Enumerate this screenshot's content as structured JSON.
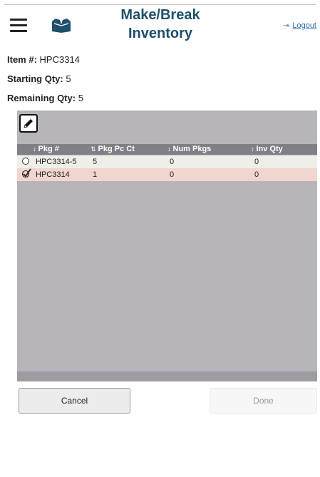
{
  "header": {
    "title_line1": "Make/Break",
    "title_line2": "Inventory",
    "logout_label": "Logout"
  },
  "info": {
    "item_label": "Item #:",
    "item_value": "HPC3314",
    "starting_label": "Starting Qty:",
    "starting_value": "5",
    "remaining_label": "Remaining Qty:",
    "remaining_value": "5"
  },
  "grid": {
    "columns": [
      "Pkg #",
      "Pkg Pc Ct",
      "Num Pkgs",
      "Inv Qty"
    ],
    "sort_glyphs": [
      "↕",
      "⇅",
      "↕",
      "↕"
    ],
    "rows": [
      {
        "pkg": "HPC3314-5",
        "pc_ct": "5",
        "num_pkgs": "0",
        "inv_qty": "0",
        "selected": false
      },
      {
        "pkg": "HPC3314",
        "pc_ct": "1",
        "num_pkgs": "0",
        "inv_qty": "0",
        "selected": true
      }
    ]
  },
  "buttons": {
    "cancel": "Cancel",
    "done": "Done"
  },
  "colors": {
    "title": "#1e4f6b",
    "link": "#2a6fa8",
    "grid_bg": "#b7b4ba",
    "header_bg": "#7f7f85",
    "selected_row": "#f0d6cf"
  }
}
